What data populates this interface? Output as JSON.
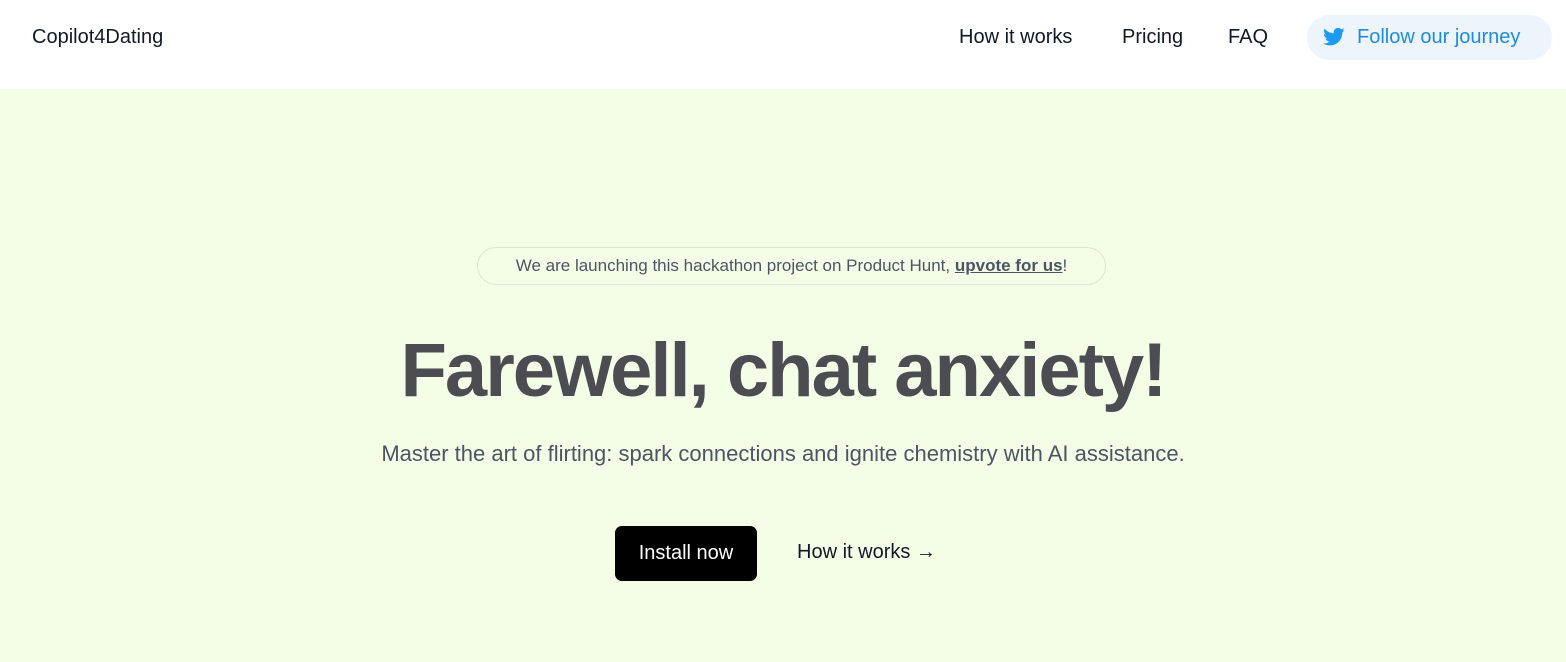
{
  "header": {
    "brand": "Copilot4Dating",
    "nav": {
      "how_it_works": "How it works",
      "pricing": "Pricing",
      "faq": "FAQ"
    },
    "follow_button": {
      "label": "Follow our journey",
      "icon": "twitter-icon",
      "color": "#1d8ce0"
    }
  },
  "hero": {
    "background": "#f4fde6",
    "announcement": {
      "text": "We are launching this hackathon project on Product Hunt, ",
      "link_label": "upvote for us",
      "suffix": "!"
    },
    "headline": "Farewell, chat anxiety!",
    "subheadline": "Master the art of flirting: spark connections and ignite chemistry with AI assistance.",
    "cta_primary": "Install now",
    "cta_secondary": "How it works →"
  }
}
